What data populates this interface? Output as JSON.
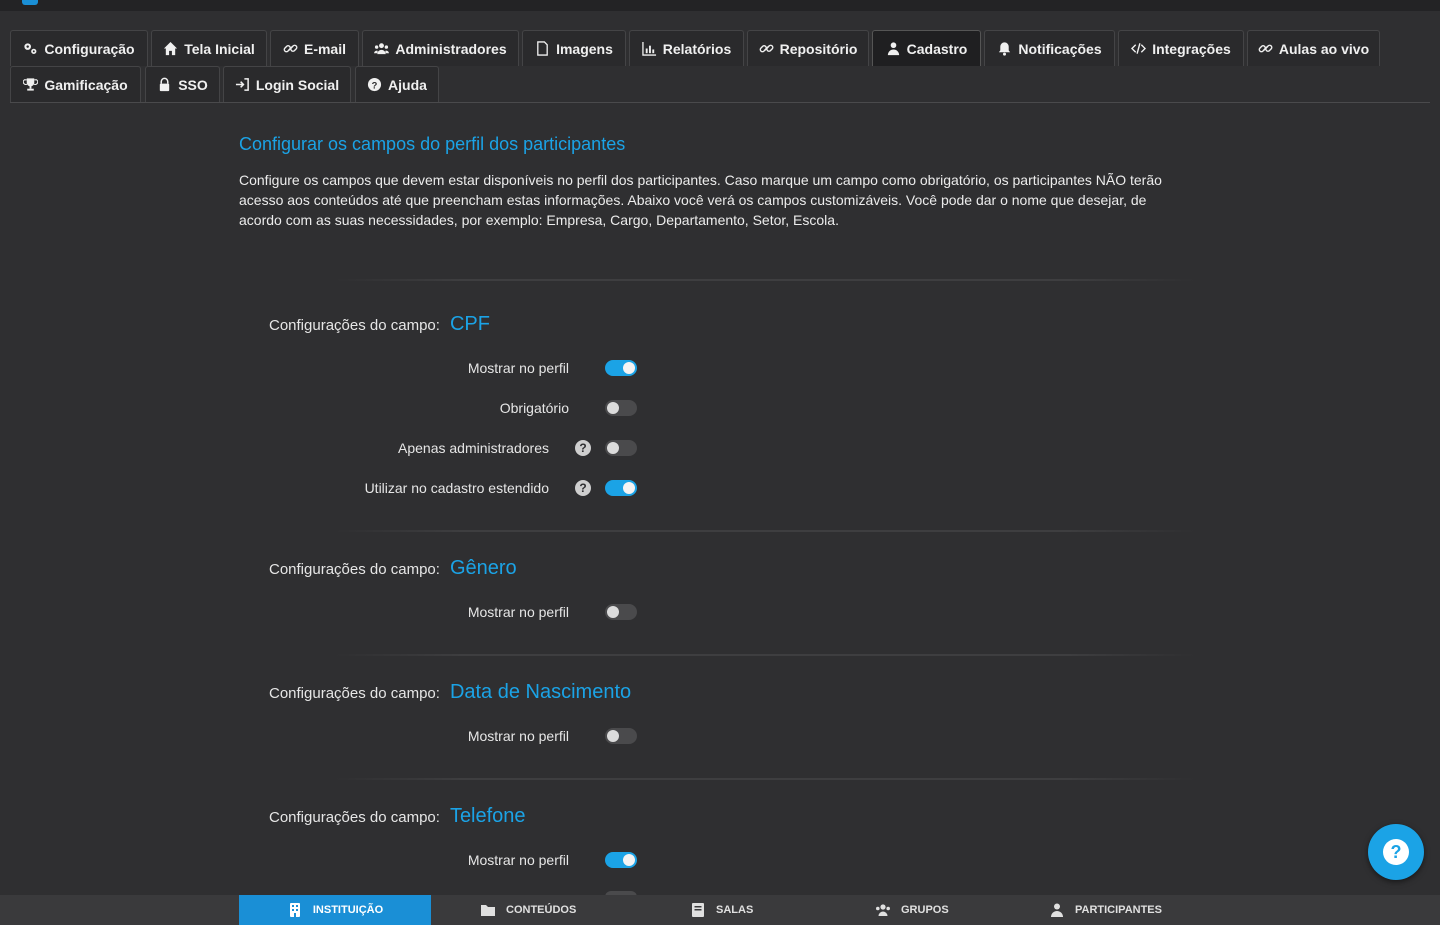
{
  "tabs": [
    {
      "label": "Configuração",
      "icon": "gears-icon",
      "active": false
    },
    {
      "label": "Tela Inicial",
      "icon": "home-icon",
      "active": false
    },
    {
      "label": "E-mail",
      "icon": "link-icon",
      "active": false
    },
    {
      "label": "Administradores",
      "icon": "users-icon",
      "active": false
    },
    {
      "label": "Imagens",
      "icon": "file-icon",
      "active": false
    },
    {
      "label": "Relatórios",
      "icon": "chart-icon",
      "active": false
    },
    {
      "label": "Repositório",
      "icon": "link-icon",
      "active": false
    },
    {
      "label": "Cadastro",
      "icon": "user-icon",
      "active": true
    },
    {
      "label": "Notificações",
      "icon": "bell-icon",
      "active": false
    },
    {
      "label": "Integrações",
      "icon": "code-icon",
      "active": false
    },
    {
      "label": "Aulas ao vivo",
      "icon": "link-icon",
      "active": false
    },
    {
      "label": "Gamificação",
      "icon": "trophy-icon",
      "active": false
    },
    {
      "label": "SSO",
      "icon": "lock-icon",
      "active": false
    },
    {
      "label": "Login Social",
      "icon": "sign-in-icon",
      "active": false
    },
    {
      "label": "Ajuda",
      "icon": "question-icon",
      "active": false
    }
  ],
  "page": {
    "title": "Configurar os campos do perfil dos participantes",
    "description": "Configure os campos que devem estar disponíveis no perfil dos participantes. Caso marque um campo como obrigatório, os participantes NÃO terão acesso aos conteúdos até que preencham estas informações. Abaixo você verá os campos customizáveis. Você pode dar o nome que desejar, de acordo com as suas necessidades, por exemplo: Empresa, Cargo, Departamento, Setor, Escola."
  },
  "field_prefix": "Configurações do campo:",
  "fields": [
    {
      "name": "CPF",
      "options": [
        {
          "label": "Mostrar no perfil",
          "on": true,
          "help": false
        },
        {
          "label": "Obrigatório",
          "on": false,
          "help": false
        },
        {
          "label": "Apenas administradores",
          "on": false,
          "help": true
        },
        {
          "label": "Utilizar no cadastro estendido",
          "on": true,
          "help": true
        }
      ]
    },
    {
      "name": "Gênero",
      "options": [
        {
          "label": "Mostrar no perfil",
          "on": false,
          "help": false
        }
      ]
    },
    {
      "name": "Data de Nascimento",
      "options": [
        {
          "label": "Mostrar no perfil",
          "on": false,
          "help": false
        }
      ]
    },
    {
      "name": "Telefone",
      "options": [
        {
          "label": "Mostrar no perfil",
          "on": true,
          "help": false
        }
      ]
    }
  ],
  "help_mark": "?",
  "bottom_nav": [
    {
      "label": "INSTITUIÇÃO",
      "icon": "building-icon",
      "active": true
    },
    {
      "label": "CONTEÚDOS",
      "icon": "folder-icon",
      "active": false
    },
    {
      "label": "SALAS",
      "icon": "book-icon",
      "active": false
    },
    {
      "label": "GRUPOS",
      "icon": "users-icon",
      "active": false
    },
    {
      "label": "PARTICIPANTES",
      "icon": "user-icon",
      "active": false
    }
  ],
  "accent_color": "#1ba3e6"
}
